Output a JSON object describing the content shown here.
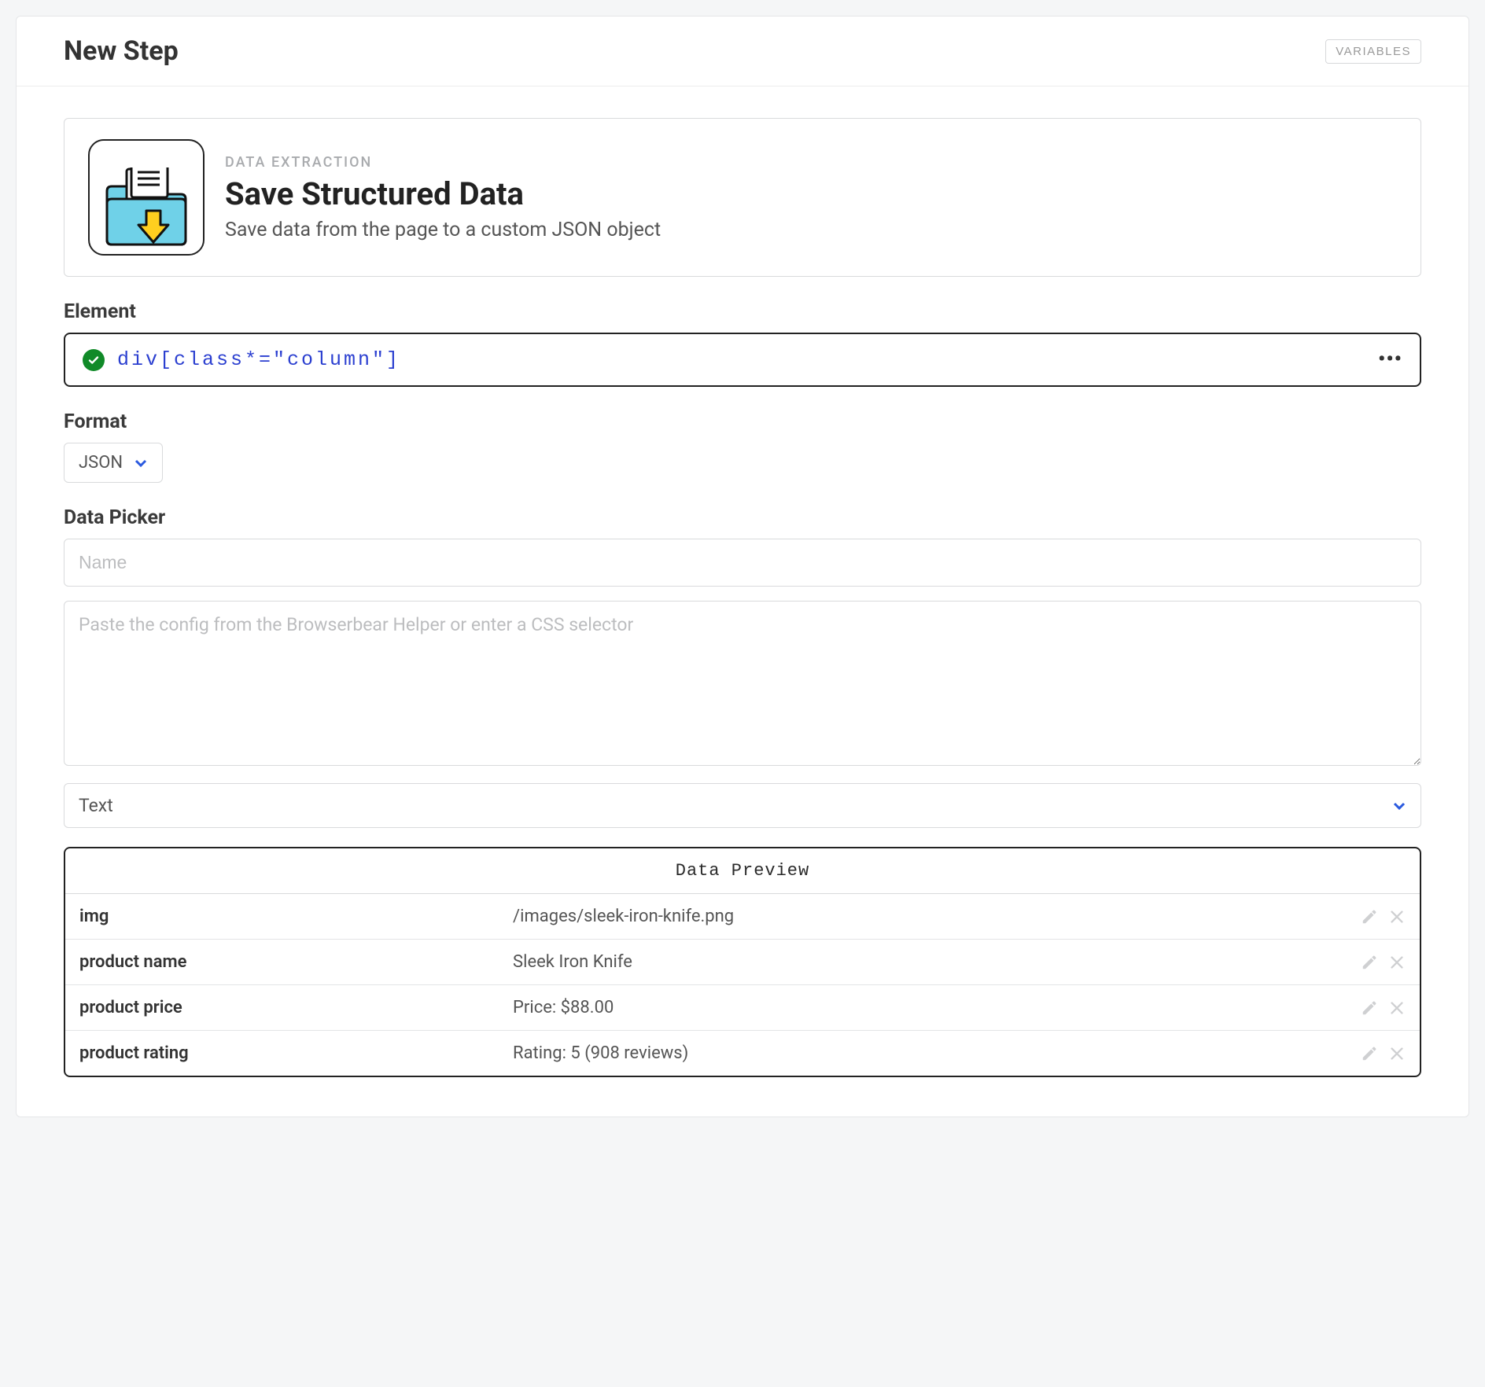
{
  "header": {
    "title": "New Step",
    "variables_button": "VARIABLES"
  },
  "step": {
    "category": "DATA EXTRACTION",
    "title": "Save Structured Data",
    "description": "Save data from the page to a custom JSON object"
  },
  "element": {
    "label": "Element",
    "selector": "div[class*=\"column\"]"
  },
  "format": {
    "label": "Format",
    "value": "JSON"
  },
  "data_picker": {
    "label": "Data Picker",
    "name_placeholder": "Name",
    "config_placeholder": "Paste the config from the Browserbear Helper or enter a CSS selector",
    "type_value": "Text"
  },
  "preview": {
    "header": "Data Preview",
    "rows": [
      {
        "key": "img",
        "value": "/images/sleek-iron-knife.png"
      },
      {
        "key": "product name",
        "value": "Sleek Iron Knife"
      },
      {
        "key": "product price",
        "value": "Price: $88.00"
      },
      {
        "key": "product rating",
        "value": "Rating: 5 (908 reviews)"
      }
    ]
  }
}
